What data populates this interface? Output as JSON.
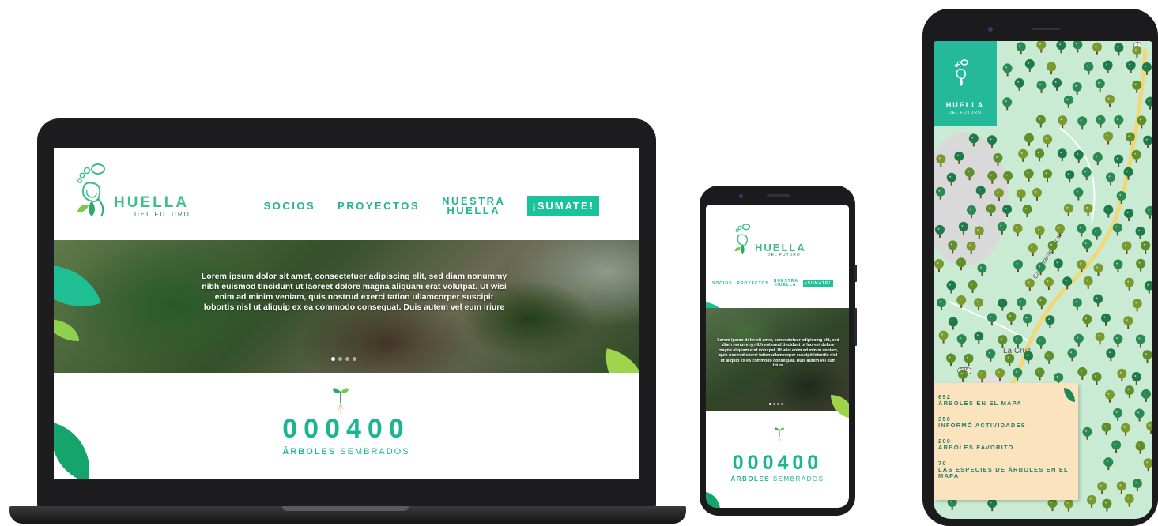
{
  "brand": {
    "name": "HUELLA",
    "tagline": "DEL FUTURO"
  },
  "nav": {
    "socios": "SOCIOS",
    "proyectos": "PROYECTOS",
    "nuestra": "NUESTRA",
    "huella": "HUELLA",
    "cta": "¡SUMATE!"
  },
  "hero": {
    "text": "Lorem ipsum dolor sit amet, consectetuer adipiscing elit, sed diam nonummy nibh euismod tincidunt ut laoreet dolore magna aliquam erat volutpat. Ut wisi enim ad minim veniam, quis nostrud exerci tation ullamcorper suscipit lobortis nisl ut aliquip ex ea commodo consequat. Duis autem vel eum iriure",
    "slides_total": 4,
    "slide_active": 1
  },
  "counter": {
    "value": "000400",
    "label_bold": "ÁRBOLES",
    "label_rest": "SEMBRADOS"
  },
  "map": {
    "place_label": "La Cruz",
    "road_label": "Carr Interamericana",
    "route_badges": [
      "935",
      "1"
    ],
    "stats": [
      {
        "value": "692",
        "label": "ÁRBOLES EN EL MAPA"
      },
      {
        "value": "350",
        "label": "INFORMÓ ACTIVIDADES"
      },
      {
        "value": "200",
        "label": "ÁRBOLES FAVORITO"
      },
      {
        "value": "70",
        "label": "LAS ESPECIES DE ÁRBOLES EN EL MAPA"
      }
    ]
  },
  "colors": {
    "brand_green": "#1cb592",
    "cta_bg": "#1cc39a",
    "leaf_light": "#8fd14f",
    "leaf_dark": "#1a9a6a",
    "map_bg": "#c9ebd3",
    "card_bg": "#fbe3bd"
  }
}
